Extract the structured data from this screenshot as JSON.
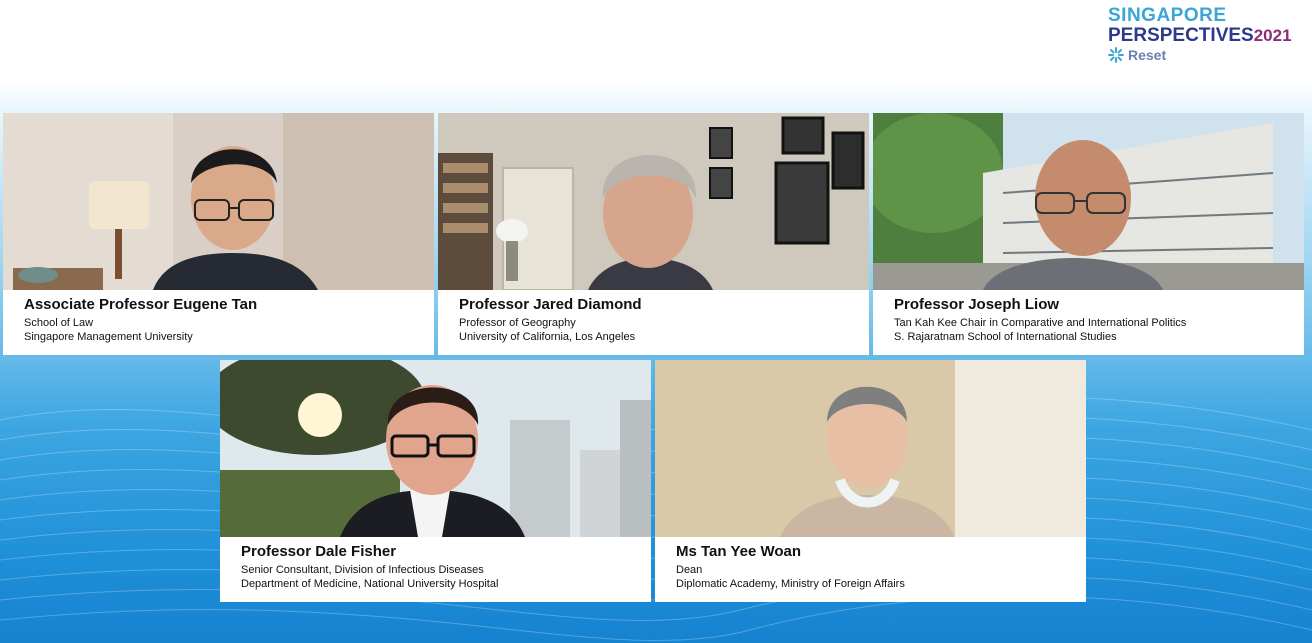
{
  "logo": {
    "line1": "SINGAPORE",
    "line2": "PERSPECTIVES",
    "year": "2021",
    "tagline": "Reset"
  },
  "panelists": [
    {
      "name": "Associate Professor Eugene Tan",
      "line1": "School of Law",
      "line2": "Singapore Management University"
    },
    {
      "name": "Professor Jared Diamond",
      "line1": "Professor of Geography",
      "line2": "University of California, Los Angeles"
    },
    {
      "name": "Professor Joseph Liow",
      "line1": "Tan Kah Kee Chair in Comparative and International Politics",
      "line2": "S. Rajaratnam School of International Studies"
    },
    {
      "name": "Professor Dale Fisher",
      "line1": "Senior Consultant, Division of Infectious Diseases",
      "line2": "Department of Medicine, National University Hospital"
    },
    {
      "name": "Ms Tan Yee Woan",
      "line1": "Dean",
      "line2": "Diplomatic Academy, Ministry of Foreign Affairs"
    }
  ],
  "colors": {
    "background_top": "#ffffff",
    "background_bottom": "#1782d0",
    "logo_cyan": "#3aa6d8",
    "logo_navy": "#2b3a8c",
    "logo_purple": "#8a2c7a"
  }
}
